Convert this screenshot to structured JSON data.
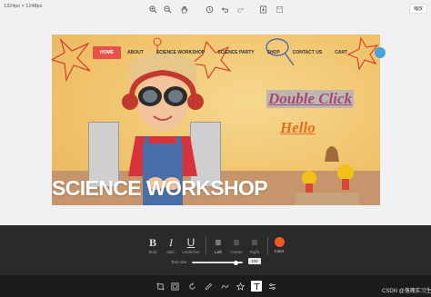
{
  "top_bar": {
    "dimensions": "1324px × 1248px",
    "zoom_chip": "缩放",
    "buttons": [
      "zoom-in-icon",
      "zoom-out-icon",
      "pan-hand-icon",
      "history-icon",
      "undo-icon",
      "redo-icon",
      "download-icon",
      "save-icon"
    ]
  },
  "banner": {
    "nav": [
      "HOME",
      "ABOUT",
      "SCIENCE WORKSHOP",
      "SCIENCE PARTY",
      "SHOP",
      "CONTACT US",
      "CART"
    ],
    "active_nav": "HOME",
    "overlay_text_1": "Double Click",
    "overlay_text_2": "Hello",
    "headline": "SCIENCE WORKSHOP"
  },
  "text_panel": {
    "formats": [
      {
        "glyph": "B",
        "label": "Bold"
      },
      {
        "glyph": "I",
        "label": "Italic"
      },
      {
        "glyph": "U",
        "label": "Underline"
      },
      {
        "glyph": "≡",
        "label": "Left"
      },
      {
        "glyph": "≡",
        "label": "Center"
      },
      {
        "glyph": "≡",
        "label": "Right"
      }
    ],
    "color_label": "Color",
    "color_value": "#f05a22",
    "size_label": "Text size",
    "size_value": "100",
    "size_fraction": 0.9
  },
  "tools": [
    "crop-icon",
    "frame-icon",
    "rotate-icon",
    "draw-icon",
    "shape-icon",
    "star-icon",
    "text-icon",
    "filter-icon"
  ],
  "active_tool": "text-icon",
  "watermark": "CSDN @落魄实习生"
}
